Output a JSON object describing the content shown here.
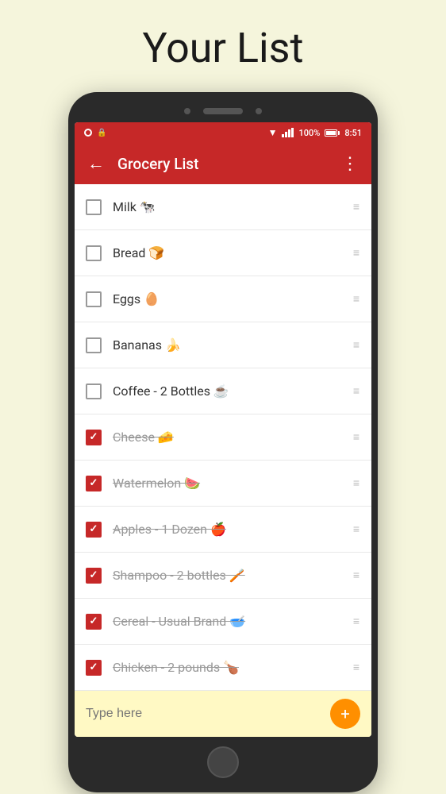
{
  "page": {
    "title": "Your List"
  },
  "appbar": {
    "back_label": "←",
    "title": "Grocery List",
    "more_label": "⋮"
  },
  "status": {
    "battery": "100%",
    "time": "8:51"
  },
  "grocery_items": [
    {
      "id": 1,
      "text": "Milk 🐄",
      "checked": false,
      "strikethrough": false
    },
    {
      "id": 2,
      "text": "Bread 🍞",
      "checked": false,
      "strikethrough": false
    },
    {
      "id": 3,
      "text": "Eggs 🥚",
      "checked": false,
      "strikethrough": false
    },
    {
      "id": 4,
      "text": "Bananas 🍌",
      "checked": false,
      "strikethrough": false
    },
    {
      "id": 5,
      "text": "Coffee - 2 Bottles ☕",
      "checked": false,
      "strikethrough": false
    },
    {
      "id": 6,
      "text": "Cheese 🧀",
      "checked": true,
      "strikethrough": true
    },
    {
      "id": 7,
      "text": "Watermelon 🍉",
      "checked": true,
      "strikethrough": true
    },
    {
      "id": 8,
      "text": "Apples - 1 Dozen 🍎",
      "checked": true,
      "strikethrough": true
    },
    {
      "id": 9,
      "text": "Shampoo - 2 bottles 🪥",
      "checked": true,
      "strikethrough": true
    },
    {
      "id": 10,
      "text": "Cereal - Usual Brand 🥣",
      "checked": true,
      "strikethrough": true
    },
    {
      "id": 11,
      "text": "Chicken - 2 pounds 🍗",
      "checked": true,
      "strikethrough": true
    }
  ],
  "input": {
    "placeholder": "Type here"
  },
  "drag_handle": "≡",
  "add_button_label": "+"
}
